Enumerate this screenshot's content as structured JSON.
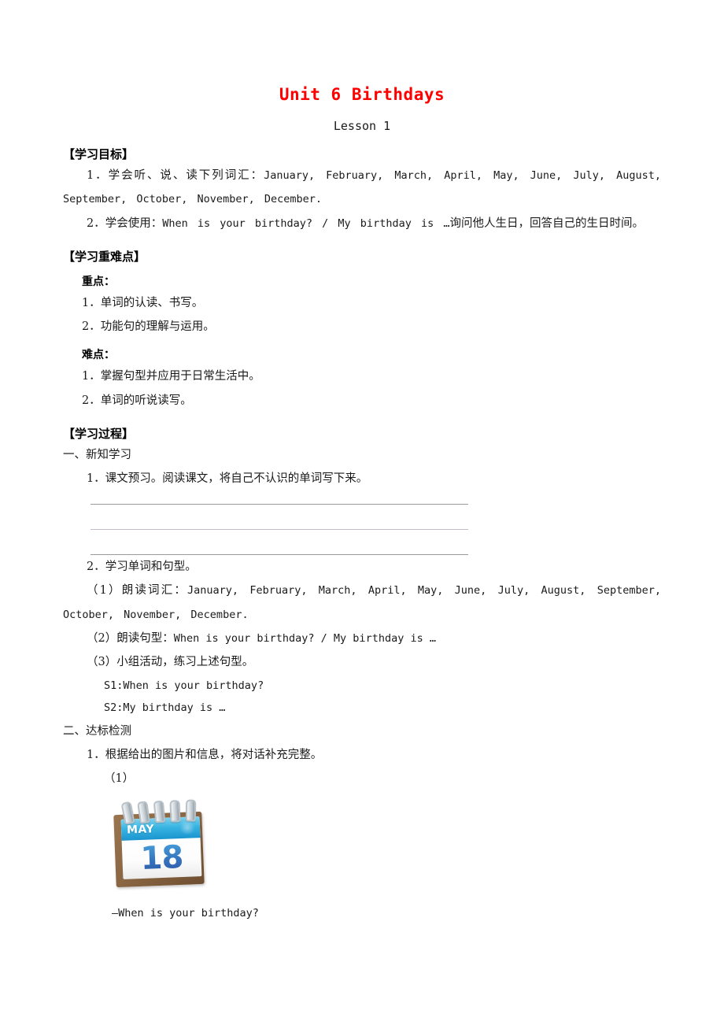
{
  "document": {
    "title": "Unit 6 Birthdays",
    "subtitle": "Lesson 1",
    "title_color": "#ff0000"
  },
  "objectives": {
    "heading": "【学习目标】",
    "items": [
      {
        "prefix": "1．学会听、说、读下列词汇：",
        "content": "January, February, March, April, May, June, July, August, September, October, November, December."
      },
      {
        "prefix": "2．学会使用：",
        "content": "When is your birthday? / My birthday is …",
        "suffix": "询问他人生日，回答自己的生日时间。"
      }
    ]
  },
  "key_points": {
    "heading": "【学习重难点】",
    "groups": [
      {
        "label": "重点：",
        "items": [
          "1．单词的认读、书写。",
          "2．功能句的理解与运用。"
        ]
      },
      {
        "label": "难点：",
        "items": [
          "1．掌握句型并应用于日常生活中。",
          "2．单词的听说读写。"
        ]
      }
    ]
  },
  "process": {
    "heading": "【学习过程】",
    "part_one": {
      "label": "一、新知学习",
      "task1": "1．课文预习。阅读课文，将自己不认识的单词写下来。",
      "blank_lines": 3,
      "task2": "2．学习单词和句型。",
      "sub_items": [
        {
          "prefix": "（1）朗读词汇：",
          "content": "January, February, March, April, May, June, July, August, September, October, November, December."
        },
        {
          "prefix": "（2）朗读句型：",
          "content": "When is your birthday? / My birthday is …"
        },
        {
          "prefix": "（3）小组活动，练习上述句型。",
          "content": ""
        }
      ],
      "dialogue": [
        "S1:When is your birthday?",
        "S2:My birthday is …"
      ]
    },
    "part_two": {
      "label": "二、达标检测",
      "task1": "1．根据给出的图片和信息，将对话补充完整。",
      "question_number": "（1）",
      "figure": {
        "name": "desk-calendar",
        "month": "MAY",
        "day": "18",
        "band_color": "#2ba7da",
        "day_color": "#3572bd",
        "frame_color": "#8a6643"
      },
      "prompt": "—When is your birthday?"
    }
  }
}
